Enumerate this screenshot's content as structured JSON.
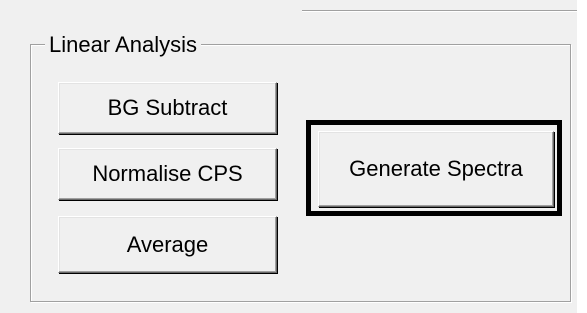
{
  "group": {
    "title": "Linear Analysis"
  },
  "buttons": {
    "bg_subtract": "BG Subtract",
    "normalise_cps": "Normalise CPS",
    "average": "Average",
    "generate_spectra": "Generate Spectra"
  },
  "colors": {
    "background": "#f0f0f0",
    "default_button_frame": "#000000"
  }
}
